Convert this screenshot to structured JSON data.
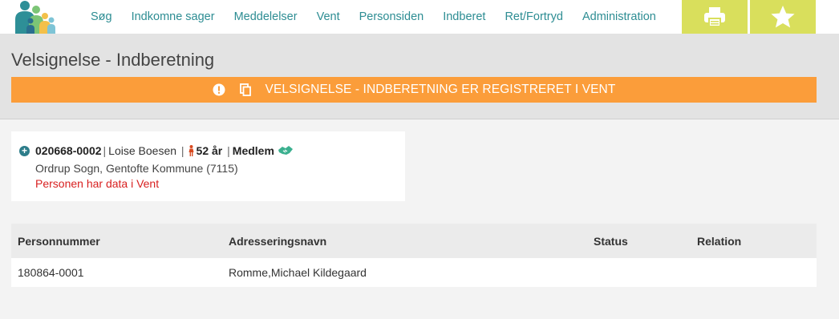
{
  "nav": {
    "items": [
      {
        "label": "Søg"
      },
      {
        "label": "Indkomne sager"
      },
      {
        "label": "Meddelelser"
      },
      {
        "label": "Vent"
      },
      {
        "label": "Personsiden"
      },
      {
        "label": "Indberet"
      },
      {
        "label": "Ret/Fortryd"
      },
      {
        "label": "Administration"
      }
    ],
    "tools": {
      "print_icon": "printer-icon",
      "favorite_icon": "star-icon"
    }
  },
  "page": {
    "title": "Velsignelse - Indberetning",
    "banner": "VELSIGNELSE - INDBERETNING ER REGISTRERET I VENT"
  },
  "person": {
    "cpr": "020668-0002",
    "name": "Loise Boesen",
    "age": "52 år",
    "membership": "Medlem",
    "parish": "Ordrup Sogn, Gentofte Kommune (7115)",
    "notice": "Personen har data i Vent"
  },
  "table": {
    "headers": [
      "Personnummer",
      "Adresseringsnavn",
      "Status",
      "Relation"
    ],
    "rows": [
      [
        "180864-0001",
        "Romme,Michael Kildegaard",
        "",
        ""
      ]
    ]
  },
  "colors": {
    "nav_text": "#2d8d93",
    "tool_button": "#d9df5c",
    "banner": "#fb9d3a",
    "notice": "#d82020"
  }
}
